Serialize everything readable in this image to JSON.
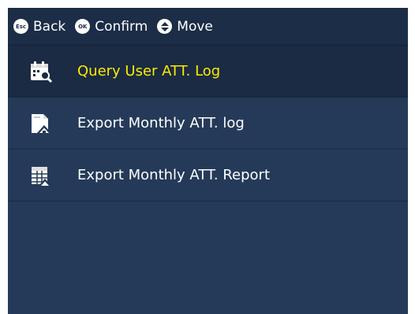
{
  "topbar": {
    "back": {
      "key": "Esc",
      "label": "Back"
    },
    "confirm": {
      "key": "OK",
      "label": "Confirm"
    },
    "move": {
      "label": "Move"
    }
  },
  "menu": {
    "items": [
      {
        "label": "Query User ATT. Log",
        "icon": "calendar-search-icon",
        "selected": true
      },
      {
        "label": "Export Monthly ATT. log",
        "icon": "document-upload-icon",
        "selected": false
      },
      {
        "label": "Export Monthly ATT. Report",
        "icon": "table-upload-icon",
        "selected": false
      }
    ]
  },
  "colors": {
    "background": "#243a58",
    "topbar": "#1b2d47",
    "selected_row": "#1a2b43",
    "selected_text": "#ffea00",
    "text": "#ffffff"
  }
}
